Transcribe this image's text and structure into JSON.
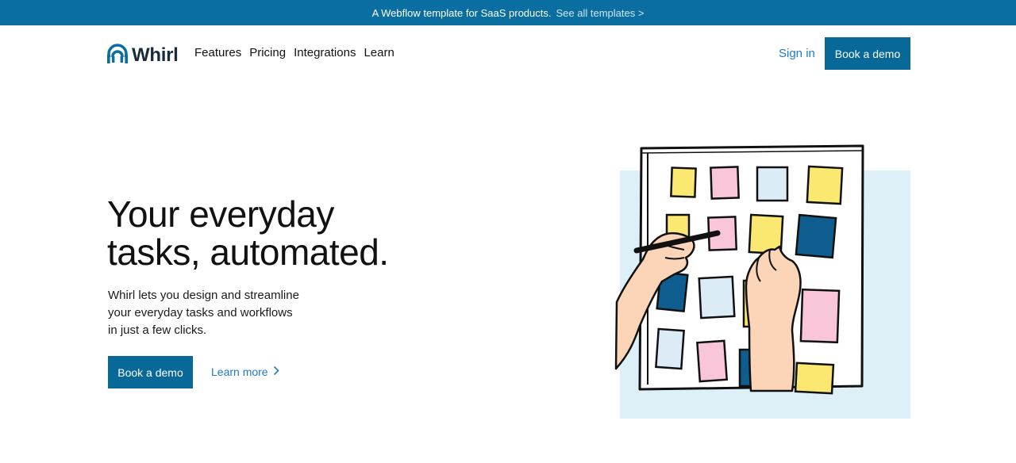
{
  "banner": {
    "text": "A Webflow template for SaaS products.",
    "link": "See all templates >"
  },
  "nav": {
    "logo_text": "Whirl",
    "menu": [
      "Features",
      "Pricing",
      "Integrations",
      "Learn"
    ],
    "sign_in": "Sign in",
    "book_demo": "Book a demo"
  },
  "hero": {
    "title_lines": [
      "Your everyday",
      "tasks, automated."
    ],
    "subtitle_lines": [
      "Whirl lets you design and streamline",
      "your everyday tasks and workflows",
      "in just a few clicks."
    ],
    "cta_primary": "Book a demo",
    "cta_secondary": "Learn more"
  },
  "colors": {
    "brand": "#086897",
    "banner_bg": "#0a6fa0",
    "link": "#1f7ac8",
    "note_yellow": "#fbe870",
    "note_pink": "#f8c6d8",
    "note_lightblue": "#dcecf6",
    "note_darkblue": "#0e5d8e",
    "illustration_bg": "#def0f7",
    "skin": "#fcd5b8"
  },
  "icons": {
    "logo": "whirl-logo-icon",
    "learn_more": "chevron-right-icon",
    "illustration": "sticky-notes-board-illustration"
  }
}
